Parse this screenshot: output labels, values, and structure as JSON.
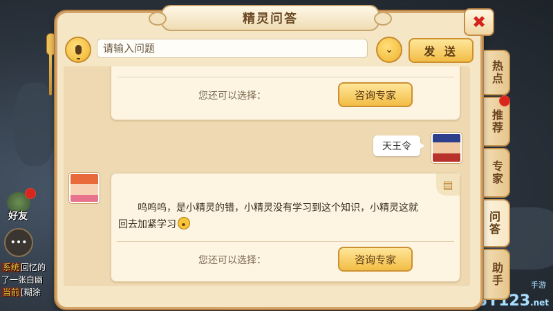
{
  "dialog": {
    "title": "精灵问答",
    "close_label": "✖"
  },
  "search": {
    "placeholder": "请输入问题",
    "send_label": "发 送"
  },
  "chat": {
    "first_block": {
      "choose_label": "您还可以选择：",
      "expert_button": "咨询专家"
    },
    "user_message": "天王令",
    "answer": {
      "text": "呜呜呜，是小精灵的错，小精灵没有学习到这个知识，小精灵这就回去加紧学习",
      "choose_label": "您还可以选择：",
      "expert_button": "咨询专家"
    }
  },
  "tabs": [
    {
      "label": "热点",
      "active": false,
      "badge": false
    },
    {
      "label": "推荐",
      "active": false,
      "badge": true
    },
    {
      "label": "专家",
      "active": false,
      "badge": false
    },
    {
      "label": "问答",
      "active": true,
      "badge": false
    },
    {
      "label": "助手",
      "active": false,
      "badge": false
    }
  ],
  "background": {
    "friend_label": "好友",
    "chat_lines": [
      {
        "tag": "系统",
        "text": "回忆的"
      },
      {
        "tag": "",
        "text": "了一张白幽"
      },
      {
        "tag": "当前",
        "text": "[糊涂"
      }
    ],
    "watermark": "SY123",
    "watermark_suffix": ".net",
    "watermark_small": "手游"
  },
  "colors": {
    "dialog_bg": "#f5e6c6",
    "button_gold": "#f2bd45",
    "close_red": "#d2231d",
    "badge_red": "#d9261c"
  }
}
